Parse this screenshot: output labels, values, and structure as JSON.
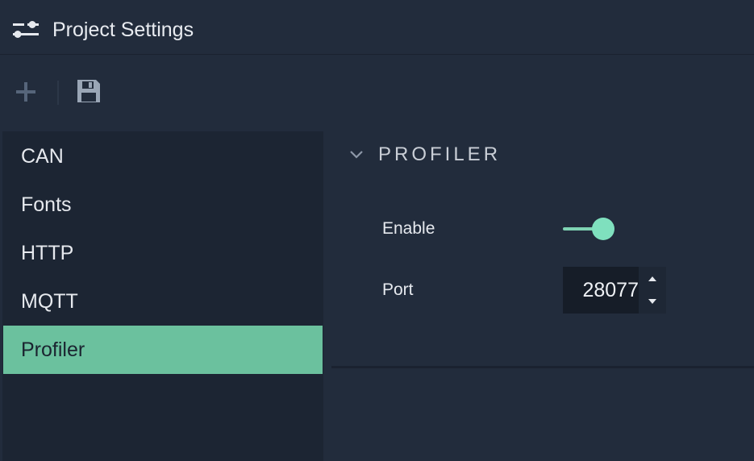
{
  "window": {
    "title": "Project Settings",
    "title_icon": "sliders-icon"
  },
  "toolbar": {
    "add_icon": "plus-icon",
    "save_icon": "save-icon"
  },
  "sidebar": {
    "items": [
      {
        "label": "CAN",
        "active": false
      },
      {
        "label": "Fonts",
        "active": false
      },
      {
        "label": "HTTP",
        "active": false
      },
      {
        "label": "MQTT",
        "active": false
      },
      {
        "label": "Profiler",
        "active": true
      }
    ]
  },
  "profiler": {
    "section_title": "PROFILER",
    "expanded": true,
    "enable_label": "Enable",
    "enable_value": true,
    "port_label": "Port",
    "port_value": "28077"
  },
  "colors": {
    "background": "#222c3c",
    "sidebar": "#1c2533",
    "accent": "#6bc19e",
    "toggle_on": "#7fe0be",
    "input_bg": "#161d28"
  }
}
